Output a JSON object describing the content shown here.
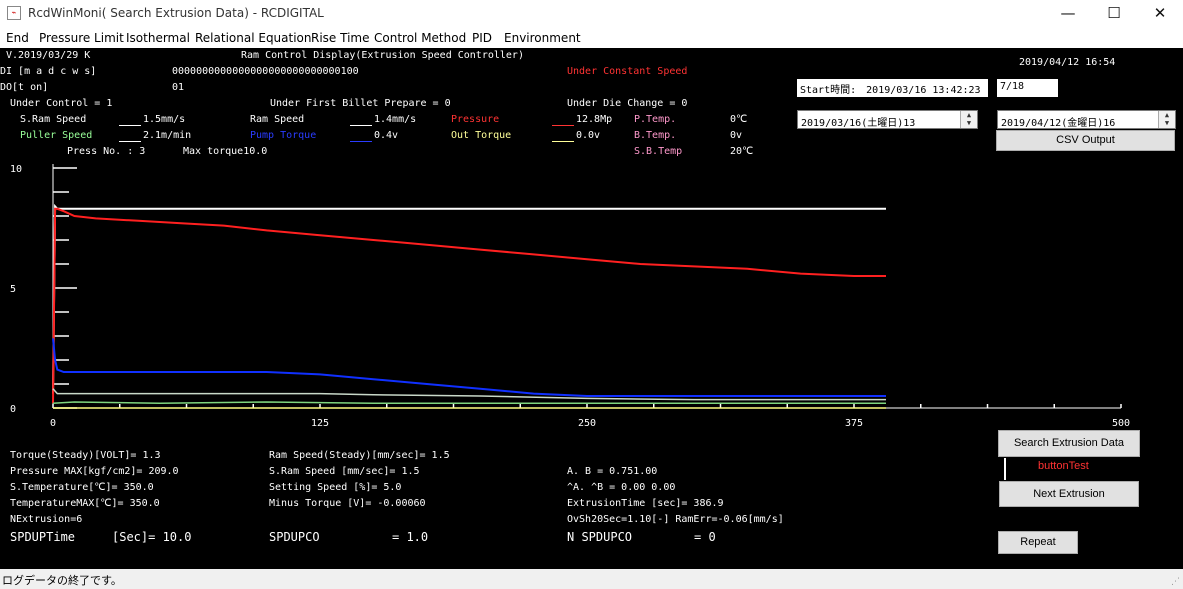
{
  "window": {
    "title": "RcdWinMoni( Search Extrusion Data)  - RCDIGITAL",
    "minimize": "—",
    "maximize": "☐",
    "close": "✕"
  },
  "menu": [
    "End",
    "Pressure Limit",
    "Isothermal",
    "Relational Equation",
    "Rise Time",
    "Control Method",
    "PID",
    "Environment"
  ],
  "header": {
    "version": "V.2019/03/29 K",
    "display_title": "Ram Control Display(Extrusion Speed Controller)",
    "date_time": "2019/04/12   16:54",
    "di_label": "DI [m a d c w s]",
    "di_bits": "0000000000000000000000000000100",
    "do_label": "DO[t on]",
    "do_bits": "01",
    "status": "Under Constant Speed",
    "under_control": "Under Control = 1",
    "first_billet": "Under First Billet Prepare = 0",
    "die_change": "Under Die Change = 0"
  },
  "readings": {
    "sram_label": "S.Ram Speed",
    "sram_value": "1.5mm/s",
    "puller_label": "Puller Speed",
    "puller_value": "2.1m/min",
    "ram_label": "Ram Speed",
    "ram_value": "1.4mm/s",
    "pump_label": "Pump Torque",
    "pump_value": "0.4v",
    "pressure_label": "Pressure",
    "pressure_value": "12.8Mp",
    "out_label": "Out Torque",
    "out_value": "0.0v",
    "ptemp_label": "P.Temp.",
    "ptemp_value": "0℃",
    "btemp_label": "B.Temp.",
    "btemp_value": "0v",
    "sbtemp_label": "S.B.Temp",
    "sbtemp_value": "20℃",
    "press_no": "Press No. : 3",
    "max_torque": "Max torque10.0"
  },
  "side": {
    "start_label": "Start時間:",
    "start_value": "2019/03/16 13:42:23",
    "counter": "7/18",
    "date_from": "2019/03/16(土曜日)13",
    "date_to": "2019/04/12(金曜日)16",
    "csv_button": "CSV Output",
    "search_button": "Search Extrusion Data",
    "button_test": "buttonTest",
    "next_button": "Next Extrusion",
    "repeat_button": "Repeat"
  },
  "summary": {
    "torque_steady": "Torque(Steady)[VOLT]= 1.3",
    "pressure_max": "Pressure MAX[kgf/cm2]= 209.0",
    "s_temperature": "S.Temperature[℃]= 350.0",
    "temperature_max": "TemperatureMAX[℃]= 350.0",
    "n_extrusion": "NExtrusion=6",
    "spdup_time_label": "SPDUPTime",
    "spdup_time_value": "[Sec]= 10.0",
    "ram_speed_steady": "Ram Speed(Steady)[mm/sec]= 1.5",
    "s_ram_speed": "S.Ram Speed  [mm/sec]= 1.5",
    "setting_speed": "Setting Speed        [%]= 5.0",
    "minus_torque": "Minus Torque        [V]= -0.00060",
    "spdupco_label": "SPDUPCO",
    "spdupco_value": "= 1.0",
    "ab": "A. B        = 0.751.00",
    "a2b": "^A. ^B      = 0.00 0.00",
    "extrusion_time": "ExtrusionTime [sec]= 386.9",
    "ovsh": "OvSh20Sec=1.10[-] RamErr=-0.06[mm/s]",
    "n_spdupco_label": "N SPDUPCO",
    "n_spdupco_value": "= 0"
  },
  "status_bar": "ログデータの終了です。",
  "chart_data": {
    "type": "line",
    "title": "",
    "xlabel": "",
    "ylabel": "",
    "xlim": [
      0,
      500
    ],
    "ylim": [
      0,
      10
    ],
    "x_ticks": [
      "0",
      "125",
      "250",
      "375",
      "500"
    ],
    "y_ticks": [
      "0",
      "5",
      "10"
    ],
    "grid": false,
    "series": [
      {
        "color": "#ffffff",
        "x": [
          0,
          1,
          2,
          3,
          390
        ],
        "y": [
          0.6,
          8.4,
          8.3,
          8.3,
          8.3
        ]
      },
      {
        "color": "#ff2020",
        "x": [
          0,
          1,
          2,
          5,
          10,
          20,
          40,
          60,
          80,
          100,
          125,
          150,
          175,
          200,
          225,
          250,
          275,
          300,
          325,
          350,
          375,
          390
        ],
        "y": [
          0.2,
          8.3,
          8.3,
          8.2,
          8.0,
          7.9,
          7.8,
          7.7,
          7.6,
          7.4,
          7.2,
          7.0,
          6.8,
          6.6,
          6.4,
          6.2,
          6.0,
          5.9,
          5.8,
          5.6,
          5.5,
          5.5
        ]
      },
      {
        "color": "#1030ff",
        "x": [
          0,
          1,
          2,
          5,
          20,
          50,
          100,
          125,
          150,
          175,
          200,
          225,
          250,
          300,
          350,
          390
        ],
        "y": [
          2.9,
          2.0,
          1.6,
          1.5,
          1.5,
          1.5,
          1.5,
          1.4,
          1.2,
          1.0,
          0.8,
          0.6,
          0.5,
          0.5,
          0.5,
          0.5
        ]
      },
      {
        "color": "#c8d8c8",
        "x": [
          0,
          2,
          10,
          50,
          100,
          125,
          150,
          200,
          250,
          300,
          390
        ],
        "y": [
          0.8,
          0.6,
          0.6,
          0.6,
          0.6,
          0.6,
          0.55,
          0.5,
          0.4,
          0.35,
          0.35
        ]
      },
      {
        "color": "#7fd67f",
        "x": [
          0,
          10,
          50,
          100,
          150,
          200,
          250,
          300,
          350,
          390
        ],
        "y": [
          0.2,
          0.25,
          0.2,
          0.25,
          0.2,
          0.2,
          0.2,
          0.2,
          0.2,
          0.2
        ]
      },
      {
        "color": "#ffff80",
        "x": [
          0,
          390
        ],
        "y": [
          0.0,
          0.0
        ]
      }
    ]
  }
}
